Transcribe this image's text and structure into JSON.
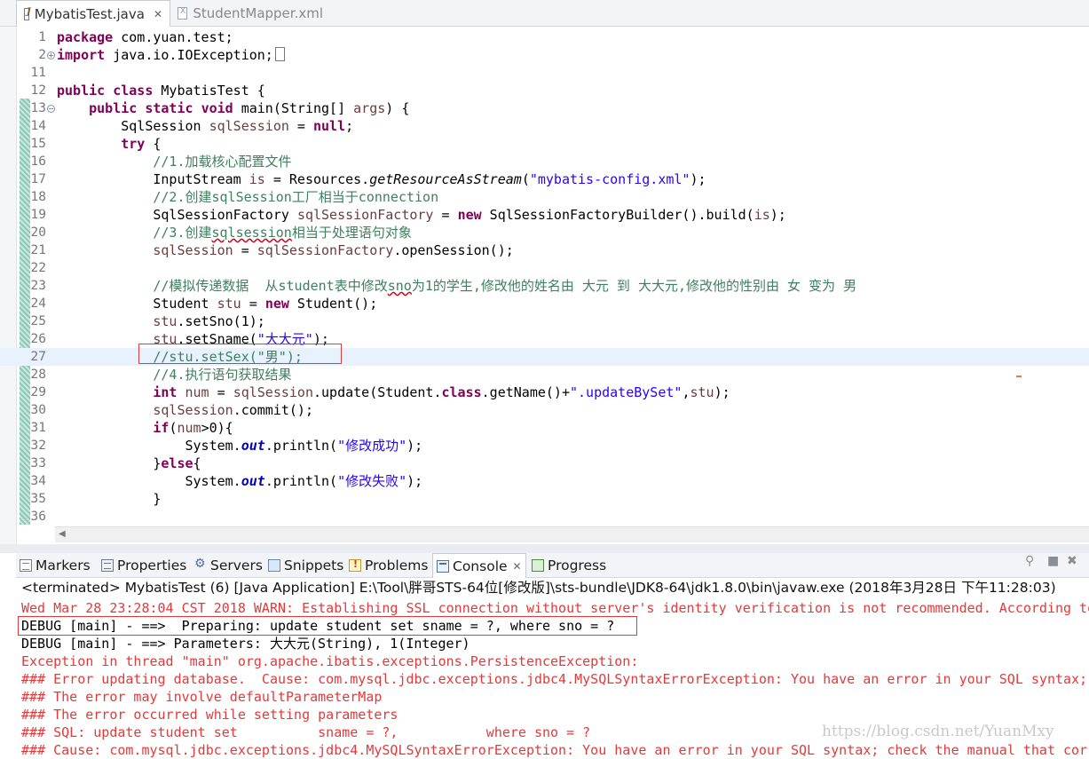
{
  "editor_tabs": [
    {
      "label": "MybatisTest.java",
      "close": "✕",
      "icon": "java-file-icon"
    },
    {
      "label": "StudentMapper.xml",
      "icon": "xml-file-icon"
    }
  ],
  "code": {
    "lines": [
      {
        "n": "1"
      },
      {
        "n": "2"
      },
      {
        "n": "11"
      },
      {
        "n": "12"
      },
      {
        "n": "13"
      },
      {
        "n": "14"
      },
      {
        "n": "15"
      },
      {
        "n": "16"
      },
      {
        "n": "17"
      },
      {
        "n": "18"
      },
      {
        "n": "19"
      },
      {
        "n": "20"
      },
      {
        "n": "21"
      },
      {
        "n": "22"
      },
      {
        "n": "23"
      },
      {
        "n": "24"
      },
      {
        "n": "25"
      },
      {
        "n": "26"
      },
      {
        "n": "27"
      },
      {
        "n": "28"
      },
      {
        "n": "29"
      },
      {
        "n": "30"
      },
      {
        "n": "31"
      },
      {
        "n": "32"
      },
      {
        "n": "33"
      },
      {
        "n": "34"
      },
      {
        "n": "35"
      },
      {
        "n": "36"
      }
    ],
    "t": {
      "l1a": "package",
      "l1b": " com.yuan.test;",
      "l2a": "import",
      "l2b": " java.io.IOException;",
      "l12a": "public",
      "l12b": " ",
      "l12c": "class",
      "l12d": " MybatisTest {",
      "l13i": "    ",
      "l13a": "public",
      "l13b": " ",
      "l13c": "static",
      "l13d": " ",
      "l13e": "void",
      "l13f": " main(String[] ",
      "l13g": "args",
      "l13h": ") {",
      "l14a": "        SqlSession ",
      "l14b": "sqlSession",
      "l14c": " = ",
      "l14d": "null",
      "l14e": ";",
      "l15i": "        ",
      "l15a": "try",
      "l15b": " {",
      "l16i": "            ",
      "l16a": "//1.加载核心配置文件",
      "l17a": "            InputStream ",
      "l17b": "is",
      "l17c": " = Resources.",
      "l17d": "getResourceAsStream",
      "l17e": "(",
      "l17f": "\"mybatis-config.xml\"",
      "l17g": ");",
      "l18i": "            ",
      "l18a": "//2.创建sqlSession工厂相当于connection",
      "l19a": "            SqlSessionFactory ",
      "l19b": "sqlSessionFactory",
      "l19c": " = ",
      "l19d": "new",
      "l19e": " SqlSessionFactoryBuilder().build(",
      "l19f": "is",
      "l19g": ");",
      "l20i": "            ",
      "l20a": "//3.创建",
      "l20b": "sqlsession",
      "l20c": "相当于处理语句对象",
      "l21i": "            ",
      "l21a": "sqlSession",
      "l21b": " = ",
      "l21c": "sqlSessionFactory",
      "l21d": ".openSession();",
      "l23i": "            ",
      "l23a": "//模拟传递数据  从student表中修改",
      "l23b": "sno",
      "l23c": "为1的学生,修改他的姓名由 大元 到 大大元,修改他的性别由 女 变为 男",
      "l24a": "            Student ",
      "l24b": "stu",
      "l24c": " = ",
      "l24d": "new",
      "l24e": " Student();",
      "l25i": "            ",
      "l25a": "stu",
      "l25b": ".setSno(1);",
      "l26i": "            ",
      "l26a": "stu",
      "l26b": ".setSname(",
      "l26c": "\"大大元\"",
      "l26d": ");",
      "l27i": "            ",
      "l27a": "//stu.setSex(\"男\");",
      "l28i": "            ",
      "l28a": "//4.执行语句获取结果",
      "l29i": "            ",
      "l29a": "int",
      "l29b": " ",
      "l29c": "num",
      "l29d": " = ",
      "l29e": "sqlSession",
      "l29f": ".update(Student.",
      "l29g": "class",
      "l29h": ".getName()+",
      "l29j": "\".updateBySet\"",
      "l29k": ",",
      "l29l": "stu",
      "l29m": ");",
      "l30i": "            ",
      "l30a": "sqlSession",
      "l30b": ".commit();",
      "l31i": "            ",
      "l31a": "if",
      "l31b": "(",
      "l31c": "num",
      "l31d": ">0){",
      "l32a": "                System.",
      "l32b": "out",
      "l32c": ".println(",
      "l32d": "\"修改成功\"",
      "l32e": ");",
      "l33a": "            }",
      "l33b": "else",
      "l33c": "{",
      "l34a": "                System.",
      "l34b": "out",
      "l34c": ".println(",
      "l34d": "\"修改失败\"",
      "l34e": ");",
      "l35a": "            }"
    }
  },
  "panel_tabs": {
    "markers": "Markers",
    "properties": "Properties",
    "servers": "Servers",
    "snippets": "Snippets",
    "problems": "Problems",
    "console": "Console",
    "console_close": "✕",
    "progress": "Progress"
  },
  "panel_tools": {
    "pin": "⚲",
    "stop": "■",
    "remove": "✖",
    "scroll_lock": "⇳"
  },
  "console": {
    "status": "<terminated> MybatisTest (6) [Java Application] E:\\Tool\\胖哥STS-64位[修改版]\\sts-bundle\\JDK8-64\\jdk1.8.0\\bin\\javaw.exe (2018年3月28日 下午11:28:03)",
    "lines": [
      "Wed Mar 28 23:28:04 CST 2018 WARN: Establishing SSL connection without server's identity verification is not recommended. According to",
      "DEBUG [main] - ==>  Preparing: update student set sname = ?, where sno = ?",
      "DEBUG [main] - ==> Parameters: 大大元(String), 1(Integer)",
      "Exception in thread \"main\" org.apache.ibatis.exceptions.PersistenceException: ",
      "### Error updating database.  Cause: com.mysql.jdbc.exceptions.jdbc4.MySQLSyntaxErrorException: You have an error in your SQL syntax;",
      "### The error may involve defaultParameterMap",
      "### The error occurred while setting parameters",
      "### SQL: update student set          sname = ?,           where sno = ?",
      "### Cause: com.mysql.jdbc.exceptions.jdbc4.MySQLSyntaxErrorException: You have an error in your SQL syntax; check the manual that corr"
    ]
  },
  "watermark": "https://blog.csdn.net/YuanMxy",
  "colors": {
    "keyword": "#7f0055",
    "string": "#2a00ff",
    "comment": "#3f7f5f",
    "error": "#e23a3a",
    "highlight_box": "#e03a3a"
  }
}
